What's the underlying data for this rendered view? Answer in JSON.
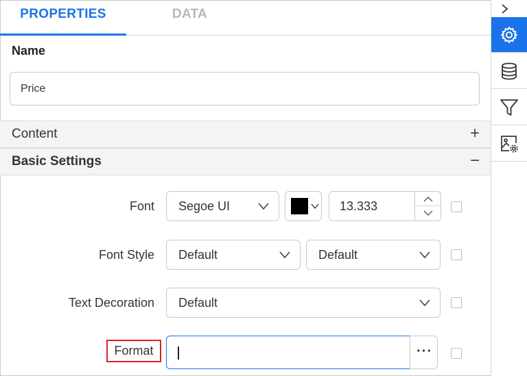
{
  "tabs": [
    {
      "label": "PROPERTIES",
      "active": true
    },
    {
      "label": "DATA",
      "active": false
    }
  ],
  "name_section": {
    "label": "Name",
    "value": "Price"
  },
  "sections": {
    "content": {
      "title": "Content",
      "toggle": "+"
    },
    "basic_settings": {
      "title": "Basic Settings",
      "toggle": "−"
    }
  },
  "font_row": {
    "label": "Font",
    "family": "Segoe UI",
    "color": "#000000",
    "size": "13.333"
  },
  "font_style_row": {
    "label": "Font Style",
    "style": "Default",
    "weight": "Default"
  },
  "text_decoration_row": {
    "label": "Text Decoration",
    "value": "Default"
  },
  "format_row": {
    "label": "Format",
    "value": "",
    "more_label": "···"
  },
  "sidebar": {
    "collapse_icon": "chevron-right-icon",
    "buttons": [
      {
        "icon": "gear-icon",
        "active": true
      },
      {
        "icon": "database-icon",
        "active": false
      },
      {
        "icon": "filter-icon",
        "active": false
      },
      {
        "icon": "image-settings-icon",
        "active": false
      }
    ]
  },
  "colors": {
    "accent": "#1a73e8",
    "highlight_border": "#e02020"
  }
}
